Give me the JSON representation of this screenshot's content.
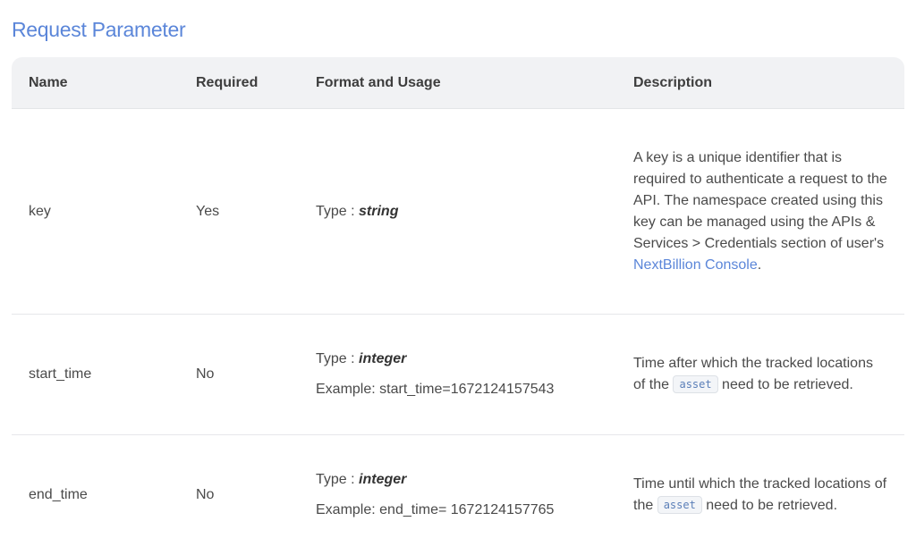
{
  "section": {
    "title": "Request Parameter"
  },
  "table": {
    "headers": {
      "name": "Name",
      "required": "Required",
      "format": "Format and Usage",
      "description": "Description"
    },
    "rows": [
      {
        "name": "key",
        "required": "Yes",
        "type_label": "Type : ",
        "type_value": "string",
        "example": "",
        "description_text": "A key is a unique identifier that is required to authenticate a request to the API. The namespace created using this key can be managed using the APIs & Services > Credentials section of user's ",
        "description_link": "NextBillion Console",
        "description_end": "."
      },
      {
        "name": "start_time",
        "required": "No",
        "type_label": "Type : ",
        "type_value": "integer",
        "example": "Example: start_time=1672124157543",
        "description_before": "Time after which the tracked locations of the ",
        "description_code": "asset",
        "description_after": " need to be retrieved."
      },
      {
        "name": "end_time",
        "required": "No",
        "type_label": "Type : ",
        "type_value": "integer",
        "example": "Example: end_time= 1672124157765",
        "description_before": "Time until which the tracked locations of the ",
        "description_code": "asset",
        "description_after": " need to be retrieved."
      }
    ]
  },
  "colors": {
    "accent": "#5b86d9",
    "header_bg": "#f1f2f4",
    "text": "#404040"
  }
}
